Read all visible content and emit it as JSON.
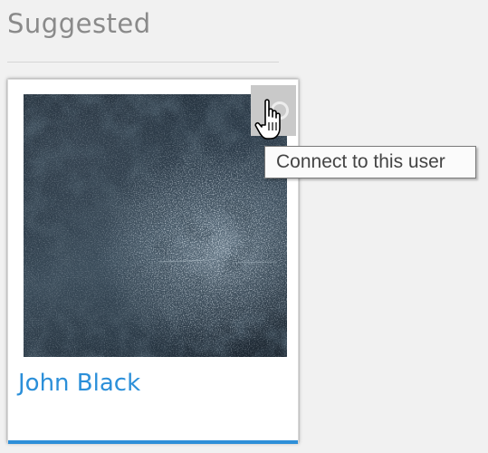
{
  "section": {
    "title": "Suggested"
  },
  "card": {
    "user_name": "John Black",
    "connect_icon": "plug-icon",
    "tooltip": "Connect to this user",
    "cursor_icon": "hand-pointer-icon"
  },
  "colors": {
    "accent": "#2e8fd8",
    "link": "#2b8fd9",
    "title": "#8a8a8a",
    "background": "#f1f1f1"
  }
}
